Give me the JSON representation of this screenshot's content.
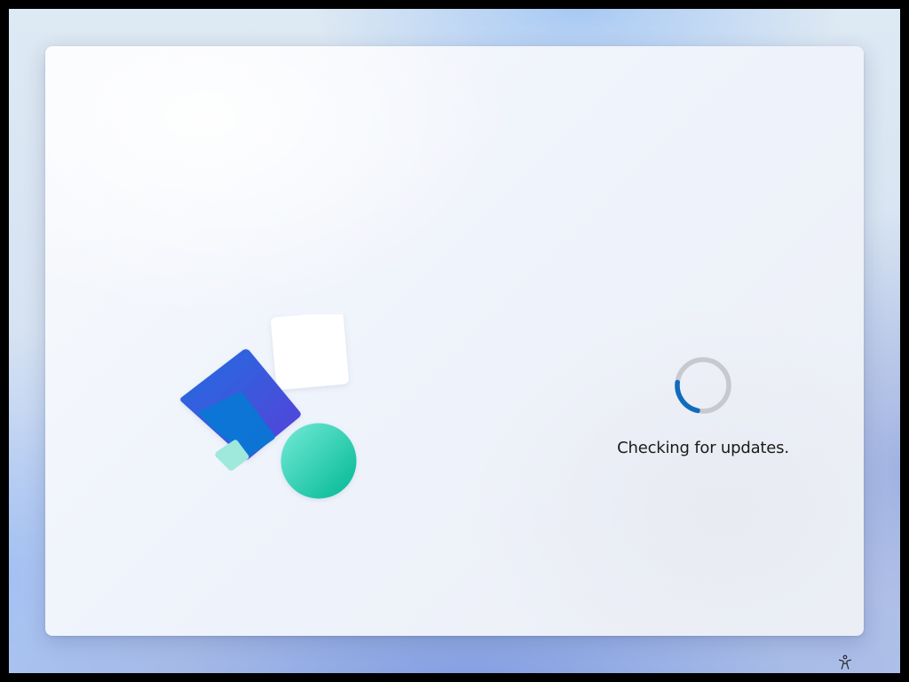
{
  "status": {
    "message": "Checking for updates.",
    "busy": true,
    "spinner_colors": {
      "track": "#c8c9ce",
      "arc": "#0f6cbd"
    }
  },
  "illustration": {
    "shapes": [
      "white-square",
      "blue-diamond",
      "mint-square",
      "teal-circle"
    ],
    "colors": {
      "blue_start": "#1f6fe0",
      "blue_end": "#5a3fd8",
      "inner_blue": "#0a78d4",
      "mint": "#9ee8dc",
      "teal_start": "#6ee7d3",
      "teal_end": "#00b894",
      "white": "#ffffff"
    }
  },
  "footer": {
    "accessibility_icon": "accessibility-icon"
  }
}
